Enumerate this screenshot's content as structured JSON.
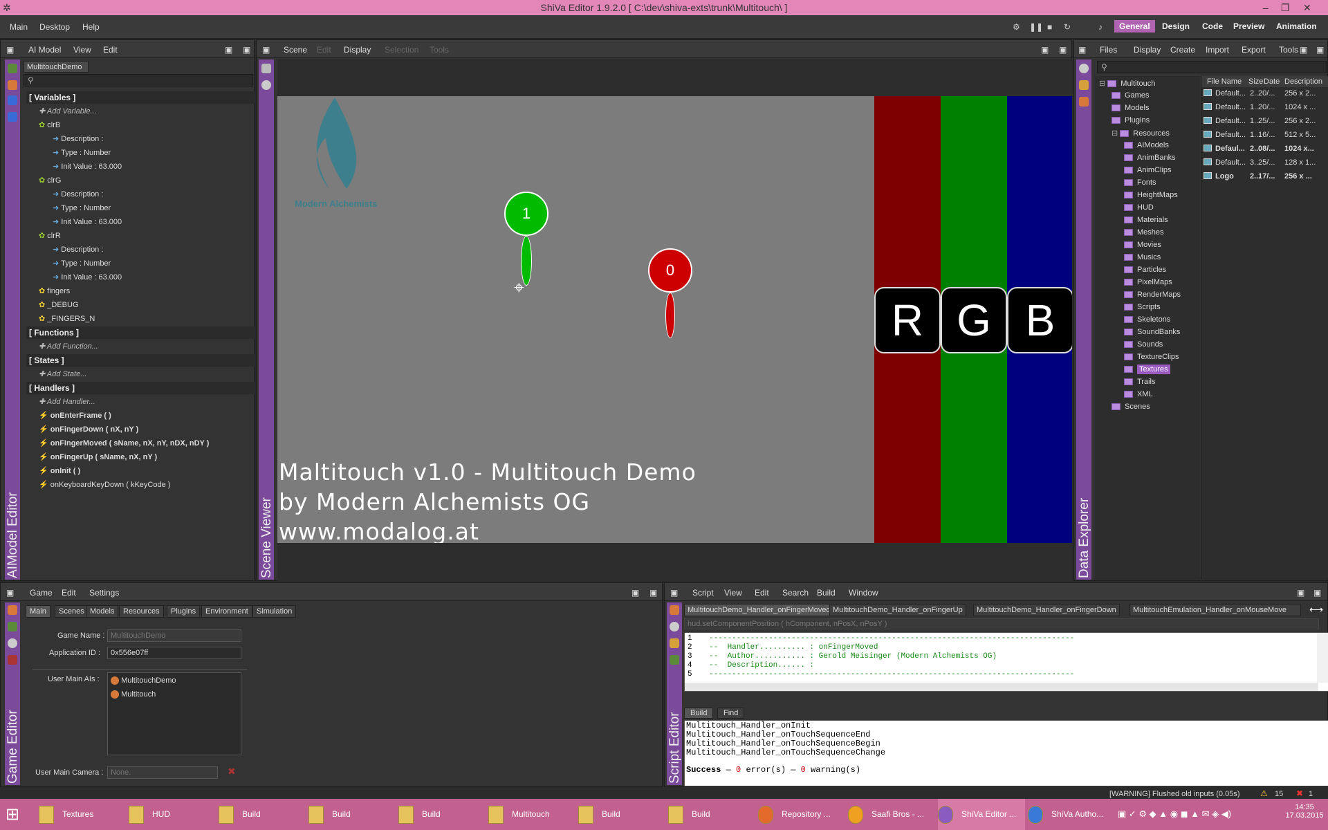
{
  "window": {
    "title": "ShiVa Editor 1.9.2.0 [ C:\\dev\\shiva-exts\\trunk\\Multitouch\\ ]"
  },
  "menu": {
    "items": [
      "Main",
      "Desktop",
      "Help"
    ]
  },
  "layout_tabs": {
    "items": [
      "General",
      "Design",
      "Code",
      "Preview",
      "Animation"
    ],
    "active": "General"
  },
  "aimodel_editor": {
    "title": "AIModel Editor",
    "menu": [
      "AI Model",
      "View",
      "Edit"
    ],
    "tab": "MultitouchDemo",
    "sections": {
      "variables": "[ Variables ]",
      "add_variable": "Add Variable...",
      "functions": "[ Functions ]",
      "add_function": "Add Function...",
      "states": "[ States ]",
      "add_state": "Add State...",
      "handlers": "[ Handlers ]",
      "add_handler": "Add Handler..."
    },
    "variables": [
      {
        "name": "clrB",
        "desc": "Description :",
        "type": "Type : Number",
        "init": "Init Value : 63.000"
      },
      {
        "name": "clrG",
        "desc": "Description :",
        "type": "Type : Number",
        "init": "Init Value : 63.000"
      },
      {
        "name": "clrR",
        "desc": "Description :",
        "type": "Type : Number",
        "init": "Init Value : 63.000"
      }
    ],
    "extra_variables": [
      "fingers",
      "_DEBUG",
      "_FINGERS_N"
    ],
    "handlers": [
      "onEnterFrame ( )",
      "onFingerDown ( nX, nY )",
      "onFingerMoved ( sName, nX, nY, nDX, nDY )",
      "onFingerUp ( sName, nX, nY )",
      "onInit ( )",
      "onKeyboardKeyDown ( kKeyCode )"
    ]
  },
  "scene_viewer": {
    "title": "Scene Viewer",
    "menu": [
      "Scene",
      "Edit",
      "Display",
      "Selection",
      "Tools"
    ],
    "logo_text": "Modern Alchemists",
    "finger1": "1",
    "finger0": "0",
    "rgb": [
      "R",
      "G",
      "B"
    ],
    "caption": [
      "Maltitouch v1.0 - Multitouch Demo",
      "by Modern Alchemists OG",
      "www.modalog.at"
    ],
    "colors": {
      "green": "#00bb00",
      "red": "#cc0000",
      "bar_r": "#7f0000",
      "bar_g": "#008000",
      "bar_b": "#00007f"
    }
  },
  "data_explorer": {
    "title": "Data Explorer",
    "menu": [
      "Files",
      "Display",
      "Create",
      "Import",
      "Export",
      "Tools"
    ],
    "tree": [
      {
        "label": "Multitouch",
        "indent": 0
      },
      {
        "label": "Games",
        "indent": 1
      },
      {
        "label": "Models",
        "indent": 1
      },
      {
        "label": "Plugins",
        "indent": 1
      },
      {
        "label": "Resources",
        "indent": 1
      },
      {
        "label": "AIModels",
        "indent": 2
      },
      {
        "label": "AnimBanks",
        "indent": 2
      },
      {
        "label": "AnimClips",
        "indent": 2
      },
      {
        "label": "Fonts",
        "indent": 2
      },
      {
        "label": "HeightMaps",
        "indent": 2
      },
      {
        "label": "HUD",
        "indent": 2
      },
      {
        "label": "Materials",
        "indent": 2
      },
      {
        "label": "Meshes",
        "indent": 2
      },
      {
        "label": "Movies",
        "indent": 2
      },
      {
        "label": "Musics",
        "indent": 2
      },
      {
        "label": "Particles",
        "indent": 2
      },
      {
        "label": "PixelMaps",
        "indent": 2
      },
      {
        "label": "RenderMaps",
        "indent": 2
      },
      {
        "label": "Scripts",
        "indent": 2
      },
      {
        "label": "Skeletons",
        "indent": 2
      },
      {
        "label": "SoundBanks",
        "indent": 2
      },
      {
        "label": "Sounds",
        "indent": 2
      },
      {
        "label": "TextureClips",
        "indent": 2
      },
      {
        "label": "Textures",
        "indent": 2,
        "selected": true
      },
      {
        "label": "Trails",
        "indent": 2
      },
      {
        "label": "XML",
        "indent": 2
      },
      {
        "label": "Scenes",
        "indent": 1
      }
    ],
    "columns": [
      "File Name",
      "Size",
      "Date",
      "Description"
    ],
    "files": [
      {
        "name": "Default...",
        "size": "2...",
        "date": "20/...",
        "desc": "256 x 2..."
      },
      {
        "name": "Default...",
        "size": "1...",
        "date": "20/...",
        "desc": "1024 x ..."
      },
      {
        "name": "Default...",
        "size": "1...",
        "date": "25/...",
        "desc": "256 x 2..."
      },
      {
        "name": "Default...",
        "size": "1...",
        "date": "16/...",
        "desc": "512 x 5..."
      },
      {
        "name": "Defaul...",
        "size": "2...",
        "date": "08/...",
        "desc": "1024 x...",
        "bold": true
      },
      {
        "name": "Default...",
        "size": "3...",
        "date": "25/...",
        "desc": "128 x 1..."
      },
      {
        "name": "Logo",
        "size": "2...",
        "date": "17/...",
        "desc": "256 x ...",
        "bold": true
      }
    ]
  },
  "game_editor": {
    "title": "Game Editor",
    "menu": [
      "Game",
      "Edit",
      "Settings"
    ],
    "tabs": [
      "Main",
      "Scenes",
      "Models",
      "Resources",
      "Plugins",
      "Environment",
      "Simulation"
    ],
    "game_name_label": "Game Name :",
    "game_name": "MultitouchDemo",
    "app_id_label": "Application ID :",
    "app_id": "0x556e07ff",
    "main_ais_label": "User Main AIs :",
    "main_ais": [
      "MultitouchDemo",
      "Multitouch"
    ],
    "camera_label": "User Main Camera :",
    "camera": "None."
  },
  "script_editor": {
    "title": "Script Editor",
    "menu": [
      "Script",
      "View",
      "Edit",
      "Search",
      "Build",
      "Window"
    ],
    "tabs": [
      "MultitouchDemo_Handler_onFingerMoved",
      "MultitouchDemo_Handler_onFingerUp",
      "MultitouchDemo_Handler_onFingerDown",
      "MultitouchEmulation_Handler_onMouseMove"
    ],
    "hint": "hud.setComponentPosition ( hComponent, nPosX, nPosY )",
    "code": [
      {
        "n": "1",
        "t": "  --------------------------------------------------------------------------------"
      },
      {
        "n": "2",
        "t": "  --  Handler.......... : onFingerMoved"
      },
      {
        "n": "3",
        "t": "  --  Author........... : Gerold Meisinger (Modern Alchemists OG)"
      },
      {
        "n": "4",
        "t": "  --  Description...... :"
      },
      {
        "n": "5",
        "t": "  --------------------------------------------------------------------------------"
      }
    ],
    "out_tabs": [
      "Build",
      "Find"
    ],
    "output": [
      "Multitouch_Handler_onInit",
      "Multitouch_Handler_onTouchSequenceEnd",
      "Multitouch_Handler_onTouchSequenceBegin",
      "Multitouch_Handler_onTouchSequenceChange"
    ],
    "success": "Success",
    "errors": "0",
    "errors_label": "error(s)",
    "warnings": "0",
    "warnings_label": "warning(s)"
  },
  "status": {
    "message": "[WARNING] Flushed old inputs (0.05s)",
    "warnings": "15",
    "errors": "1"
  },
  "taskbar": {
    "items": [
      "Textures",
      "HUD",
      "Build",
      "Build",
      "Build",
      "Multitouch",
      "Build",
      "Build",
      "Repository ...",
      "Saafi Bros - ...",
      "ShiVa Editor ...",
      "ShiVa Autho..."
    ],
    "time": "14:35",
    "date": "17.03.2015"
  }
}
